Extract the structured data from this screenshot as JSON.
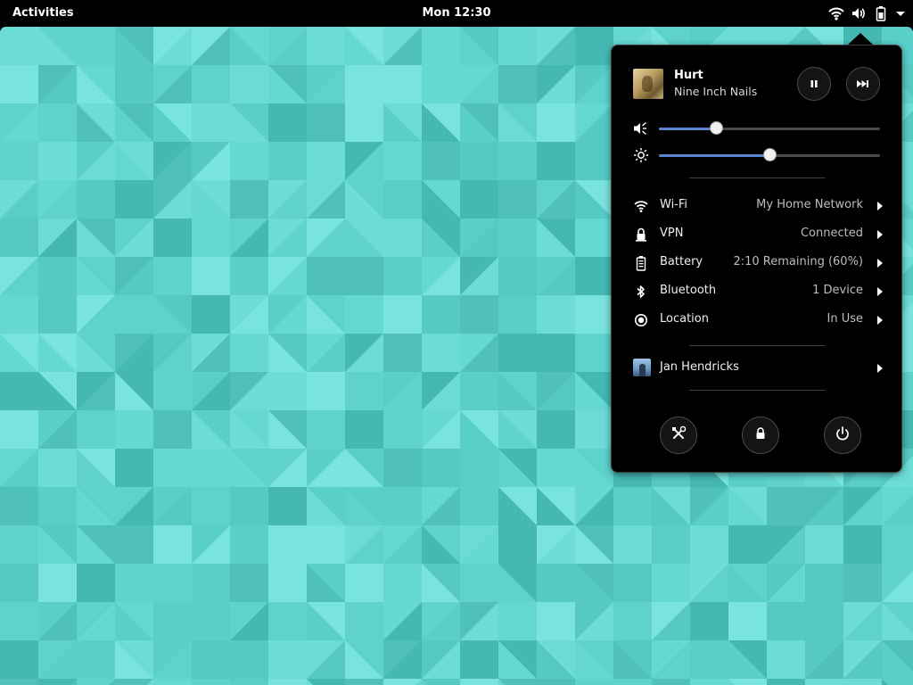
{
  "topbar": {
    "activities_label": "Activities",
    "clock": "Mon 12:30",
    "status_icons": [
      "wifi-icon",
      "volume-icon",
      "battery-icon",
      "dropdown-arrow-icon"
    ]
  },
  "media": {
    "title": "Hurt",
    "artist": "Nine Inch Nails",
    "controls": [
      "pause-icon",
      "skip-forward-icon"
    ]
  },
  "sliders": {
    "volume": {
      "icon": "volume-icon",
      "level": 0.26
    },
    "brightness": {
      "icon": "brightness-icon",
      "level": 0.5
    }
  },
  "menu_items": [
    {
      "icon": "wifi-icon",
      "label": "Wi-Fi",
      "value": "My Home Network"
    },
    {
      "icon": "vpn-lock-icon",
      "label": "VPN",
      "value": "Connected"
    },
    {
      "icon": "battery-icon",
      "label": "Battery",
      "value": "2:10 Remaining (60%)"
    },
    {
      "icon": "bluetooth-icon",
      "label": "Bluetooth",
      "value": "1 Device"
    },
    {
      "icon": "location-icon",
      "label": "Location",
      "value": "In Use"
    }
  ],
  "user": {
    "name": "Jan Hendricks"
  },
  "actions": [
    "settings-icon",
    "lock-icon",
    "power-icon"
  ],
  "colors": {
    "topbar_bg": "#000000",
    "menu_bg": "#000000",
    "slider_accent": "#5987d1",
    "desktop_teal": "#5fd2cc"
  }
}
